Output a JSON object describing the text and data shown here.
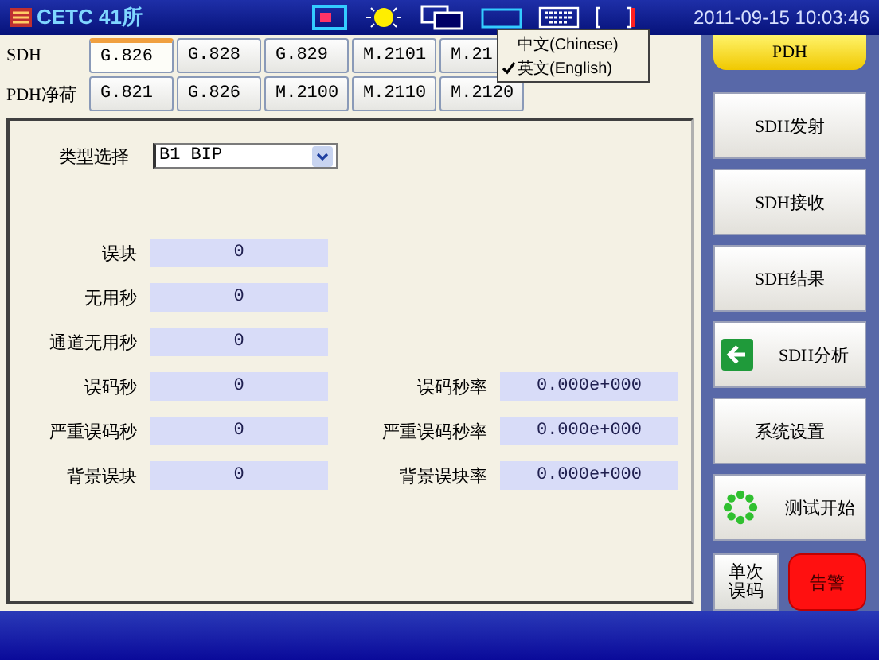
{
  "top_bar": {
    "logo": "CETC 41所",
    "datetime": "2011-09-15 10:03:46"
  },
  "tab_rows": [
    {
      "label": "SDH",
      "tabs": [
        {
          "label": "G.826",
          "selected": true
        },
        {
          "label": "G.828",
          "selected": false
        },
        {
          "label": "G.829",
          "selected": false
        },
        {
          "label": "M.2101",
          "selected": false
        },
        {
          "label": "M.21",
          "selected": false
        }
      ]
    },
    {
      "label": "PDH净荷",
      "tabs": [
        {
          "label": "G.821",
          "selected": false
        },
        {
          "label": "G.826",
          "selected": false
        },
        {
          "label": "M.2100",
          "selected": false
        },
        {
          "label": "M.2110",
          "selected": false
        },
        {
          "label": "M.2120",
          "selected": false
        }
      ]
    }
  ],
  "language_menu": [
    {
      "label": "中文(Chinese)",
      "selected": false
    },
    {
      "label": "英文(English)",
      "selected": true
    }
  ],
  "type_select": {
    "label": "类型选择",
    "value": "B1 BIP"
  },
  "results": [
    {
      "label": "误块",
      "value": "0"
    },
    {
      "label": "无用秒",
      "value": "0"
    },
    {
      "label": "通道无用秒",
      "value": "0"
    },
    {
      "label": "误码秒",
      "value": "0",
      "rate_label": "误码秒率",
      "rate_value": "0.000e+000"
    },
    {
      "label": "严重误码秒",
      "value": "0",
      "rate_label": "严重误码秒率",
      "rate_value": "0.000e+000"
    },
    {
      "label": "背景误块",
      "value": "0",
      "rate_label": "背景误块率",
      "rate_value": "0.000e+000"
    }
  ],
  "side_header": "PDH",
  "side_buttons": [
    {
      "label": "SDH发射",
      "kind": "plain"
    },
    {
      "label": "SDH接收",
      "kind": "plain"
    },
    {
      "label": "SDH结果",
      "kind": "plain"
    },
    {
      "label": "SDH分析",
      "kind": "arrow"
    },
    {
      "label": "系统设置",
      "kind": "plain"
    },
    {
      "label": "测试开始",
      "kind": "spinner"
    }
  ],
  "single_error_button": "单次误码",
  "alarm_button": "告警"
}
